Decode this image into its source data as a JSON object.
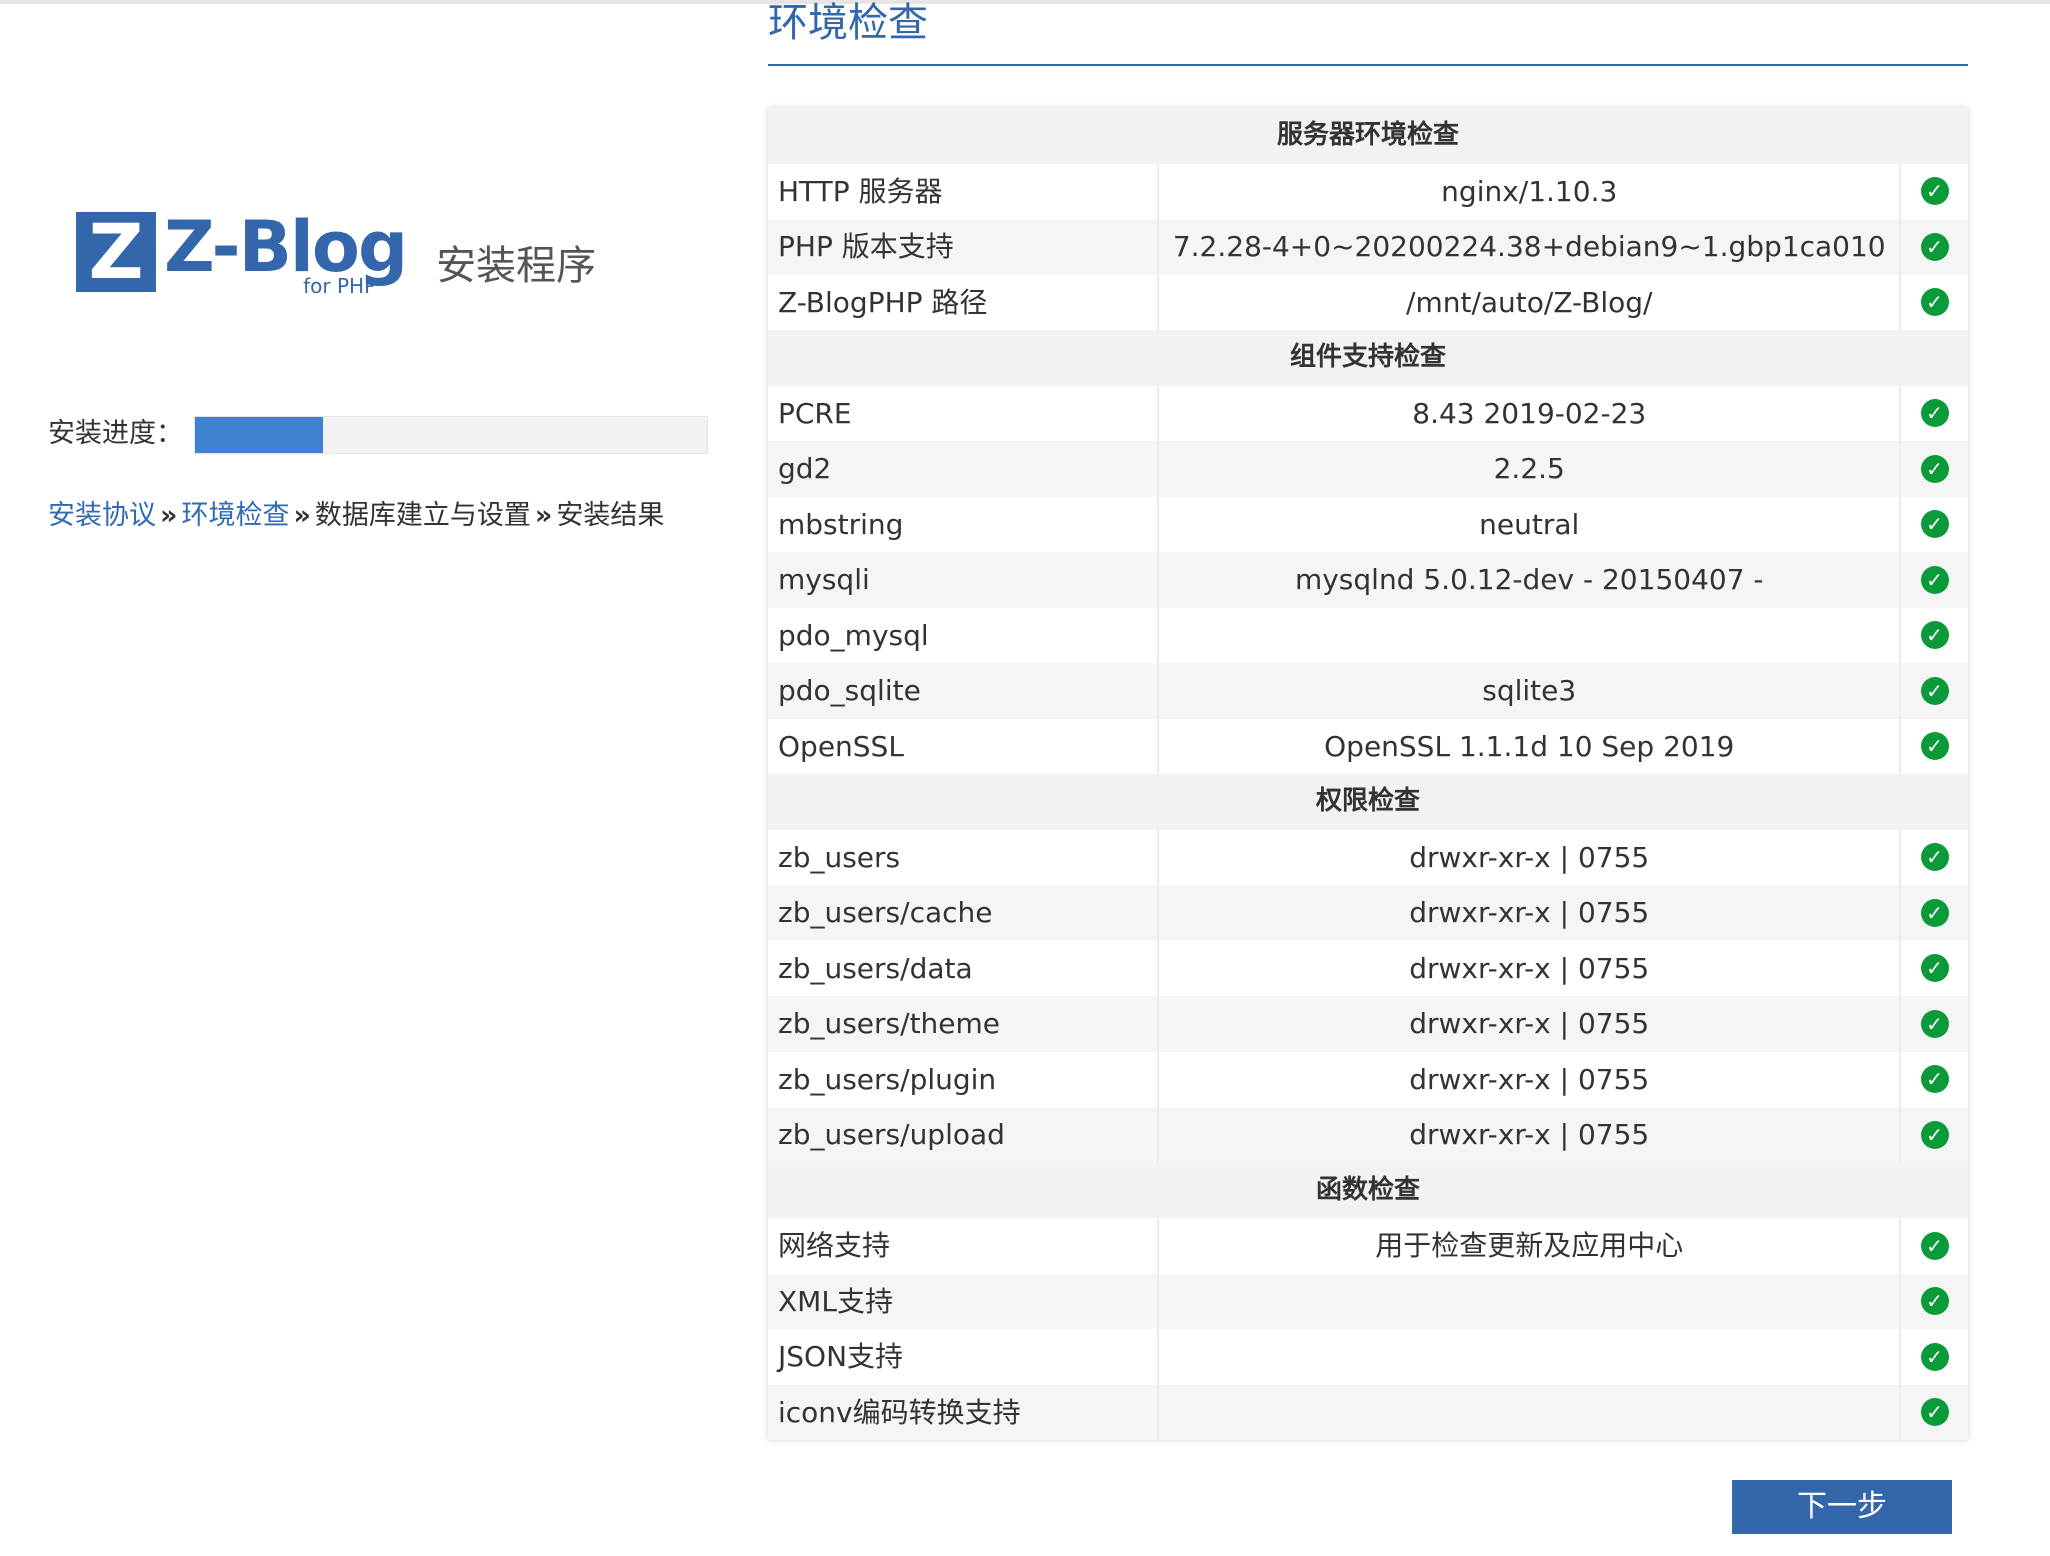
{
  "logo": {
    "mark": "Z",
    "wordmark": "Z-Blog",
    "tagline": "for PHP",
    "suffix": "安装程序"
  },
  "progress": {
    "label": "安装进度：",
    "value": 0.25,
    "color": "#3f82d1"
  },
  "steps": [
    {
      "label": "安装协议",
      "done": true
    },
    {
      "label": "环境检查",
      "done": true
    },
    {
      "label": "数据库建立与设置",
      "done": false
    },
    {
      "label": "安装结果",
      "done": false
    }
  ],
  "step_separator": "»",
  "page_title": "环境检查",
  "sections": [
    {
      "title": "服务器环境检查",
      "rows": [
        {
          "name": "HTTP 服务器",
          "value": "nginx/1.10.3",
          "status": "ok"
        },
        {
          "name": "PHP 版本支持",
          "value": "7.2.28-4+0~20200224.38+debian9~1.gbp1ca010",
          "status": "ok"
        },
        {
          "name": "Z-BlogPHP 路径",
          "value": "/mnt/auto/Z-Blog/",
          "status": "ok"
        }
      ]
    },
    {
      "title": "组件支持检查",
      "rows": [
        {
          "name": "PCRE",
          "value": "8.43 2019-02-23",
          "status": "ok"
        },
        {
          "name": "gd2",
          "value": "2.2.5",
          "status": "ok"
        },
        {
          "name": "mbstring",
          "value": "neutral",
          "status": "ok"
        },
        {
          "name": "mysqli",
          "value": "mysqlnd 5.0.12-dev - 20150407 -",
          "status": "ok"
        },
        {
          "name": "pdo_mysql",
          "value": "",
          "status": "ok"
        },
        {
          "name": "pdo_sqlite",
          "value": "sqlite3",
          "status": "ok"
        },
        {
          "name": "OpenSSL",
          "value": "OpenSSL 1.1.1d 10 Sep 2019",
          "status": "ok"
        }
      ]
    },
    {
      "title": "权限检查",
      "rows": [
        {
          "name": "zb_users",
          "value": "drwxr-xr-x | 0755",
          "status": "ok"
        },
        {
          "name": "zb_users/cache",
          "value": "drwxr-xr-x | 0755",
          "status": "ok"
        },
        {
          "name": "zb_users/data",
          "value": "drwxr-xr-x | 0755",
          "status": "ok"
        },
        {
          "name": "zb_users/theme",
          "value": "drwxr-xr-x | 0755",
          "status": "ok"
        },
        {
          "name": "zb_users/plugin",
          "value": "drwxr-xr-x | 0755",
          "status": "ok"
        },
        {
          "name": "zb_users/upload",
          "value": "drwxr-xr-x | 0755",
          "status": "ok"
        }
      ]
    },
    {
      "title": "函数检查",
      "rows": [
        {
          "name": "网络支持",
          "value": "用于检查更新及应用中心",
          "status": "ok"
        },
        {
          "name": "XML支持",
          "value": "",
          "status": "ok"
        },
        {
          "name": "JSON支持",
          "value": "",
          "status": "ok"
        },
        {
          "name": "iconv编码转换支持",
          "value": "",
          "status": "ok"
        }
      ]
    }
  ],
  "status_icon": "check-circle-icon",
  "colors": {
    "brand": "#3466ac",
    "ok": "#0a9a3a"
  },
  "next_button": "下一步"
}
